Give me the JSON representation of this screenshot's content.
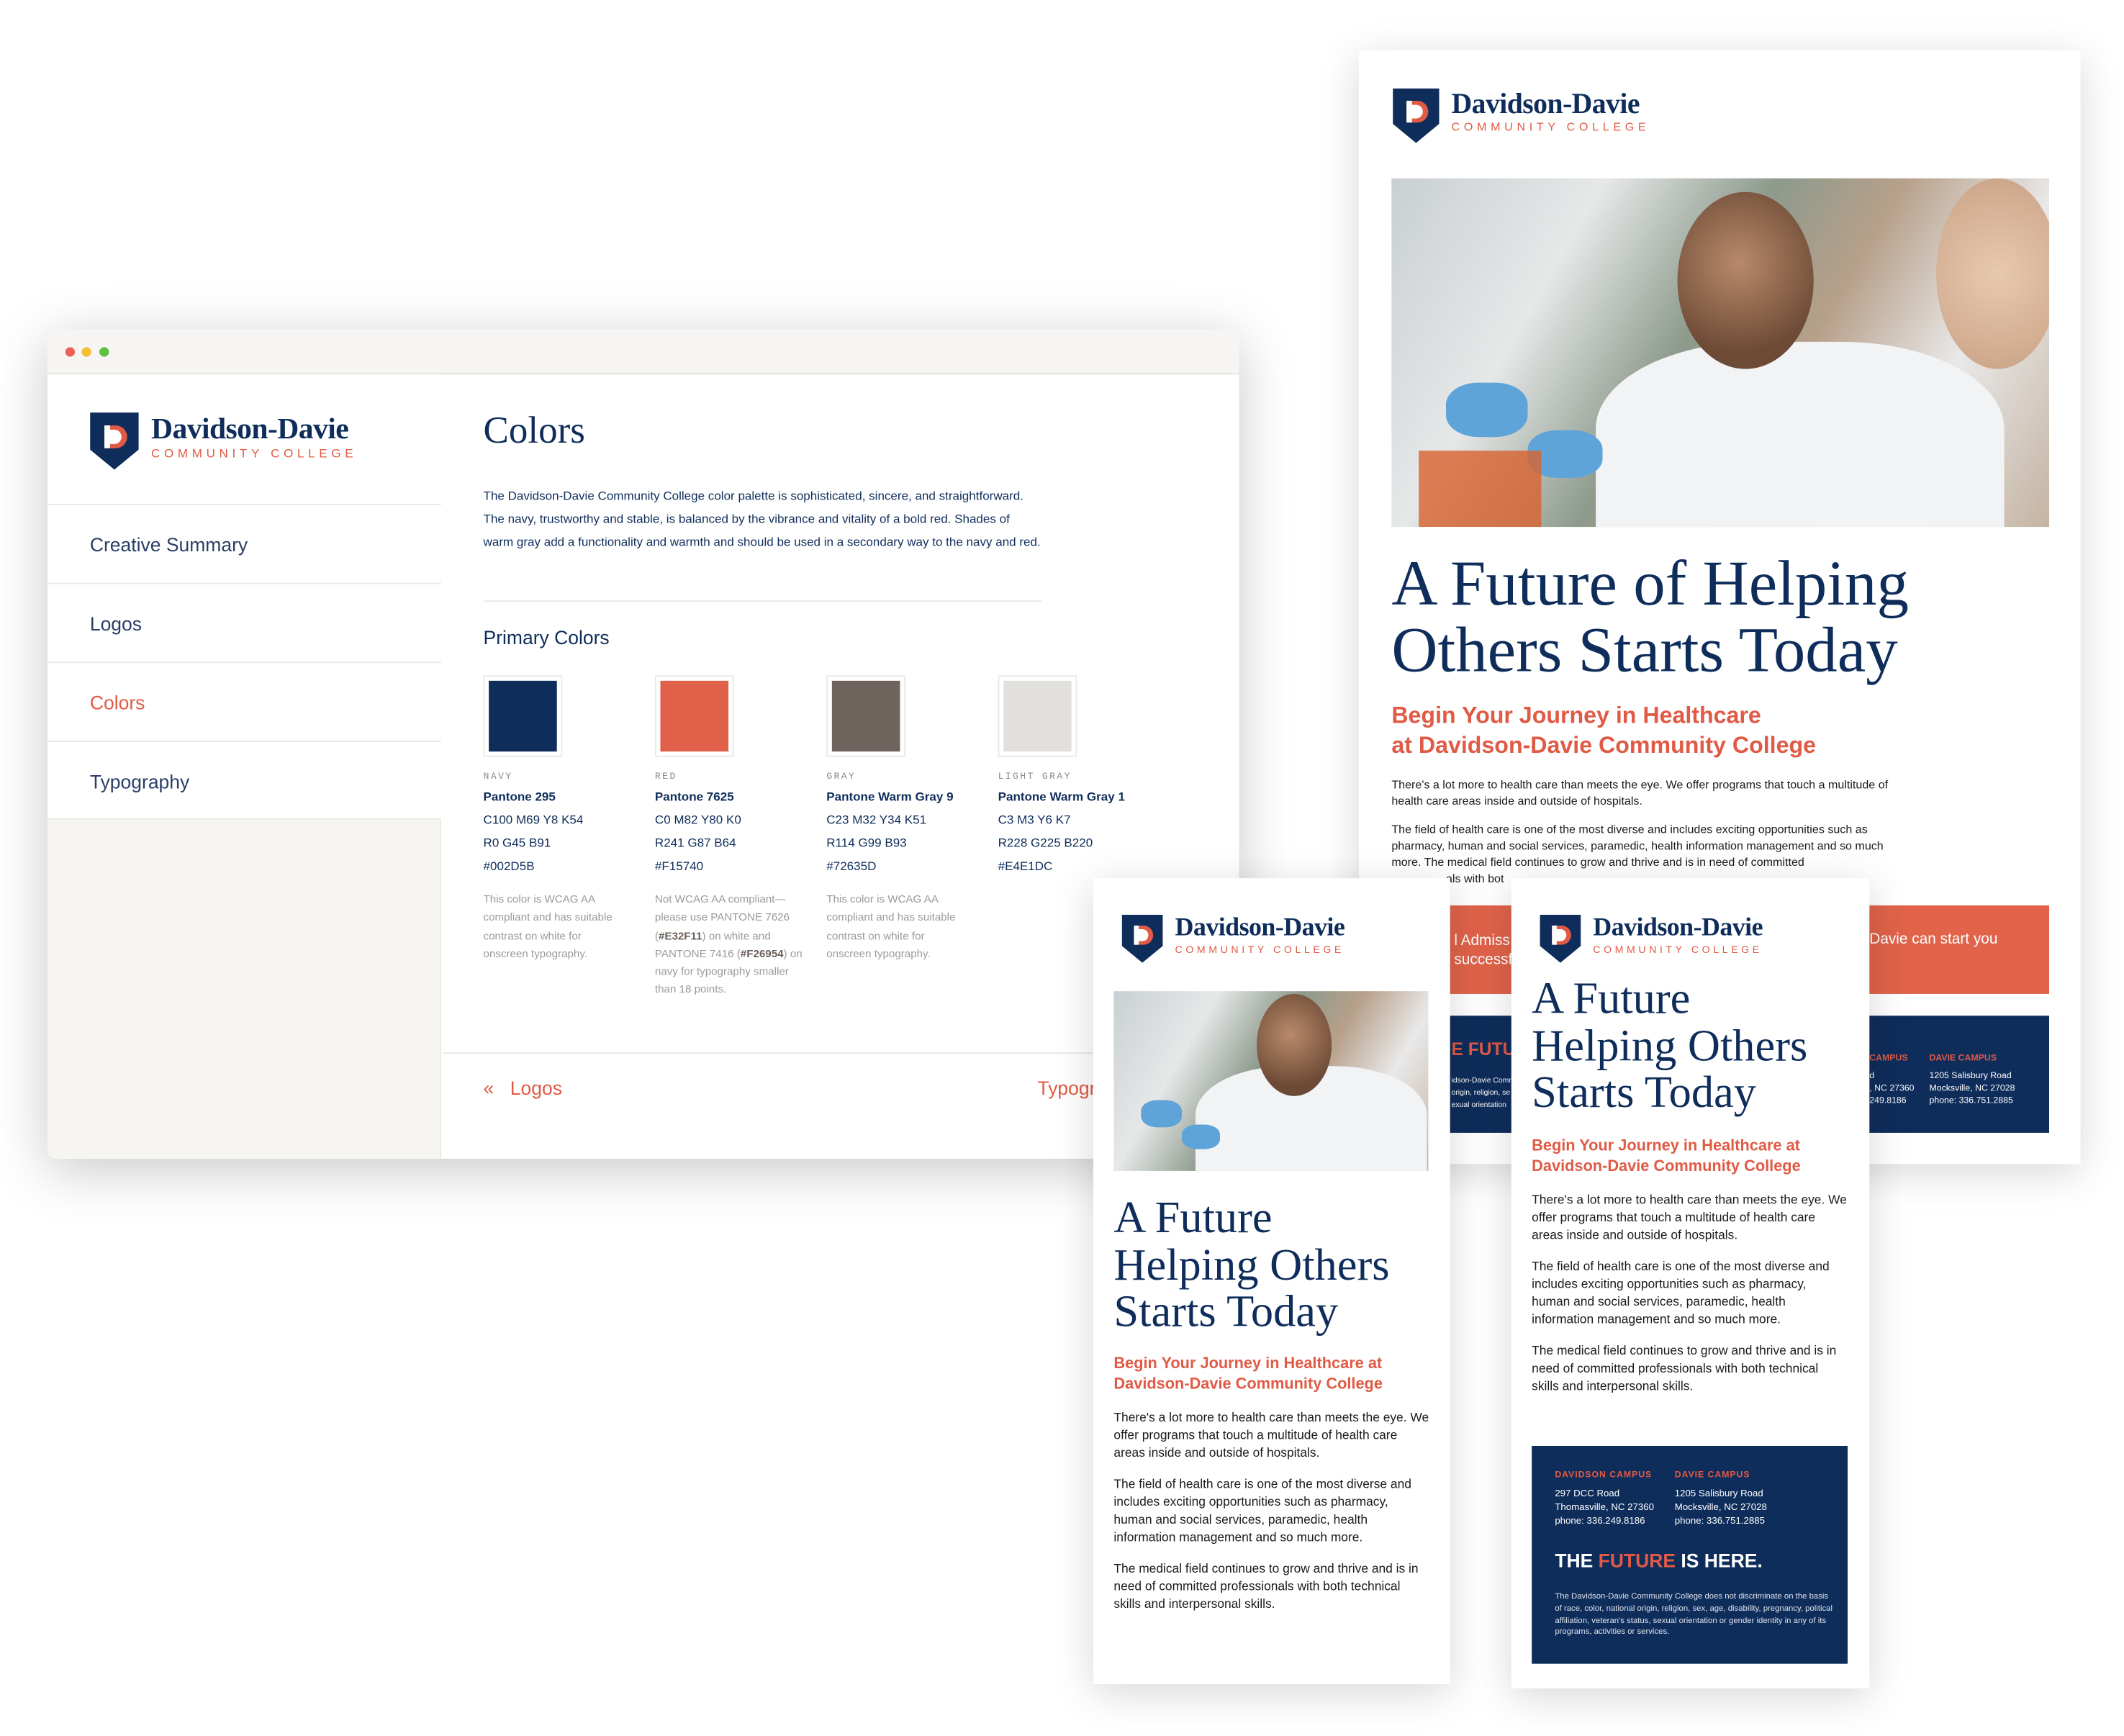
{
  "brand": {
    "name": "Davidson-Davie",
    "tagline": "COMMUNITY COLLEGE",
    "colors": {
      "navy": "#0F2D5B",
      "red": "#E05A45",
      "gray": "#6F635D",
      "light_gray": "#E4E1DC"
    }
  },
  "browser": {
    "window_controls": [
      "close",
      "minimize",
      "maximize"
    ],
    "sidebar": {
      "items": [
        {
          "label": "Creative Summary"
        },
        {
          "label": "Logos"
        },
        {
          "label": "Colors",
          "active": true
        },
        {
          "label": "Typography"
        }
      ]
    },
    "main": {
      "title": "Colors",
      "intro": "The Davidson-Davie Community College color palette is sophisticated, sincere, and straightforward. The navy, trustworthy and stable, is balanced by the vibrance and vitality of a bold red. Shades of warm gray add a functionality and warmth and should be used in a secondary way to the navy and red.",
      "section_title": "Primary Colors",
      "swatches": [
        {
          "label": "NAVY",
          "name": "Pantone 295",
          "cmyk": "C100 M69 Y8 K54",
          "rgb": "R0 G45 B91",
          "hex": "#002D5B",
          "color": "#0F2D5B",
          "note": "This color is WCAG AA compliant and has suitable contrast on white for onscreen typography."
        },
        {
          "label": "RED",
          "name": "Pantone 7625",
          "cmyk": "C0 M82 Y80 K0",
          "rgb": "R241 G87 B64",
          "hex": "#F15740",
          "color": "#E0604A",
          "note_parts": [
            "Not WCAG AA compliant—please use PANTONE 7626 (",
            "#E32F11",
            ") on white and PANTONE 7416 (",
            "#F26954",
            ") on navy for typography smaller than 18 points."
          ]
        },
        {
          "label": "GRAY",
          "name": "Pantone Warm Gray 9",
          "cmyk": "C23 M32 Y34 K51",
          "rgb": "R114 G99 B93",
          "hex": "#72635D",
          "color": "#6F635D",
          "note": "This color is WCAG AA compliant and has suitable contrast on white for onscreen typography."
        },
        {
          "label": "LIGHT GRAY",
          "name": "Pantone Warm Gray 1",
          "cmyk": "C3 M3 Y6 K7",
          "rgb": "R228 G225 B220",
          "hex": "#E4E1DC",
          "color": "#E2E0DC"
        }
      ],
      "prev_label": "Logos",
      "prev_icon": "«",
      "next_label": "Typogr"
    }
  },
  "flyer_back": {
    "headline": [
      "A Future of Helping",
      "Others Starts Today"
    ],
    "subhead": [
      "Begin Your Journey in Healthcare",
      "at Davidson-Davie Community College"
    ],
    "para1": "There's a lot more to health care than meets the eye. We offer programs that touch a multitude of health care areas inside and outside of hospitals.",
    "para2": "The field of health care is one of the most diverse and includes exciting opportunities such as pharmacy, human and social services, paramedic, health information management and so much more. The medical field continues to grow and thrive and is in need of committed",
    "para2_tail": "als with bot",
    "orange_frag_left": [
      "l Admiss",
      "successf"
    ],
    "orange_frag_right": "Davie can start you",
    "navy_frag_left": {
      "future": "E FUTU",
      "lines": [
        "idson-Davie Comm",
        "origin, religion, se",
        "exual orientation"
      ]
    },
    "navy_frag_right": {
      "campus1": "CAMPUS",
      "lines1": [
        "d",
        ", NC 27360",
        "249.8186"
      ],
      "campus2": "DAVIE CAMPUS",
      "lines2": [
        "1205 Salisbury Road",
        "Mocksville, NC 27028",
        "phone: 336.751.2885"
      ]
    }
  },
  "flyer_mid": {
    "headline": [
      "A Future",
      "Helping Others",
      "Starts Today"
    ],
    "subhead": [
      "Begin Your Journey in Healthcare at",
      "Davidson-Davie Community College"
    ],
    "paras": [
      "There's a lot more to health care than meets the eye. We offer programs that touch a multitude of health care areas inside and outside of hospitals.",
      "The field of health care is one of the most diverse and includes exciting opportunities such as pharmacy, human and social services, paramedic, health information management and so much more.",
      "The medical field continues to grow and thrive and is in need of committed professionals with both technical skills and interpersonal skills."
    ]
  },
  "flyer_right": {
    "headline": [
      "A Future",
      "Helping Others",
      "Starts Today"
    ],
    "subhead": [
      "Begin Your Journey in Healthcare at",
      "Davidson-Davie Community College"
    ],
    "paras": [
      "There's a lot more to health care than meets the eye. We offer programs that touch a multitude of health care areas inside and outside of hospitals.",
      "The field of health care is one of the most diverse and includes exciting opportunities such as pharmacy, human and social services, paramedic, health information management and so much more.",
      "The medical field continues to grow and thrive and is in need of committed professionals with both technical skills and interpersonal skills."
    ],
    "campuses": [
      {
        "title": "DAVIDSON CAMPUS",
        "lines": [
          "297 DCC Road",
          "Thomasville, NC 27360",
          "phone: 336.249.8186"
        ]
      },
      {
        "title": "DAVIE CAMPUS",
        "lines": [
          "1205 Salisbury Road",
          "Mocksville, NC 27028",
          "phone: 336.751.2885"
        ]
      }
    ],
    "slogan": {
      "pre": "THE ",
      "accent": "FUTURE",
      "post": " IS HERE."
    },
    "disclaimer": "The Davidson-Davie Community College does not discriminate on the basis of race, color, national origin, religion, sex, age, disability, pregnancy, political affiliation, veteran's status, sexual orientation or gender identity in any of its programs, activities or services."
  }
}
